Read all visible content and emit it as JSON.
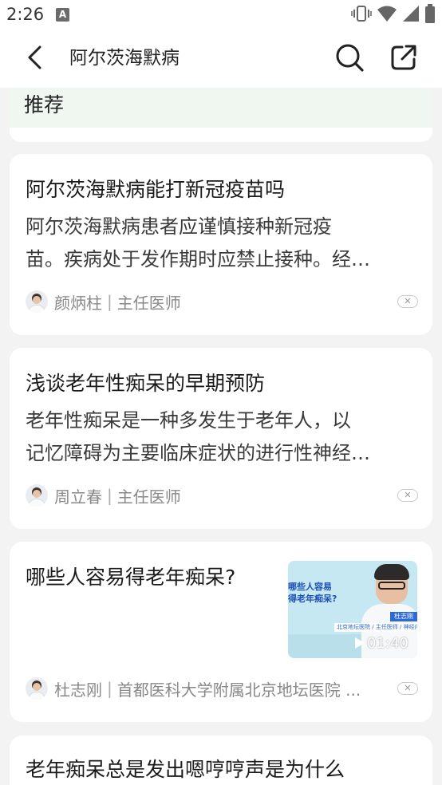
{
  "status_bar": {
    "time": "2:26",
    "notification_badge": "A",
    "icons": [
      "vibrate-icon",
      "wifi-icon",
      "signal-icon",
      "battery-icon"
    ]
  },
  "app_bar": {
    "title": "阿尔茨海默病",
    "back_icon": "chevron-left-icon",
    "search_icon": "search-icon",
    "share_icon": "share-icon"
  },
  "section": {
    "label": "推荐"
  },
  "cards": [
    {
      "title": "阿尔茨海默病能打新冠疫苗吗",
      "summary_lines": [
        "阿尔茨海默病患者应谨慎接种新冠疫",
        "苗。疾病处于发作期时应禁止接种。经…"
      ],
      "author": "颜炳柱",
      "separator": "|",
      "author_title": "主任医师"
    },
    {
      "title": "浅谈老年性痴呆的早期预防",
      "summary_lines": [
        "老年性痴呆是一种多发生于老年人，以",
        "记忆障碍为主要临床症状的进行性神经…"
      ],
      "author": "周立春",
      "separator": "|",
      "author_title": "主任医师"
    },
    {
      "title": "哪些人容易得老年痴呆?",
      "author": "杜志刚",
      "separator": "|",
      "author_title": "首都医科大学附属北京地坛医院 ...",
      "video": {
        "duration": "01:40",
        "thumb_lines": [
          "哪些人容易",
          "得老年痴呆?"
        ],
        "thumb_name": "杜志刚",
        "thumb_info": "北京地坛医院 / 主任医师 / 神经内科"
      }
    },
    {
      "title": "老年痴呆总是发出嗯哼哼声是为什么"
    }
  ],
  "colors": {
    "page_background": "#f3f3f3",
    "card_background": "#ffffff",
    "recommend_band": "#eff7f0",
    "secondary_text": "#888888"
  }
}
